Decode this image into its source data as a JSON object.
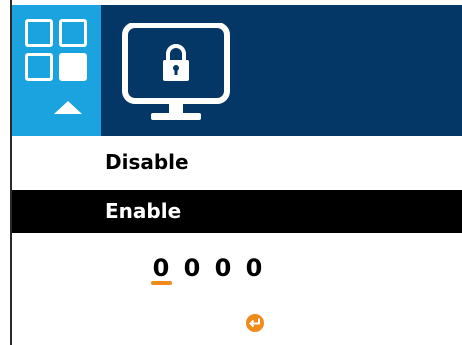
{
  "header": {
    "menu_icon": "grid-menu-icon",
    "up_icon": "up-arrow-icon",
    "section_icon": "monitor-lock-icon"
  },
  "options": [
    {
      "label": "Disable",
      "selected": false
    },
    {
      "label": "Enable",
      "selected": true
    }
  ],
  "pin": {
    "digits": [
      "0",
      "0",
      "0",
      "0"
    ],
    "active_index": 0
  },
  "footer": {
    "enter_icon": "enter-icon"
  },
  "colors": {
    "header_bg": "#043666",
    "menu_tile_bg": "#1aa3de",
    "selected_row_bg": "#000000",
    "accent": "#f08a1c"
  }
}
